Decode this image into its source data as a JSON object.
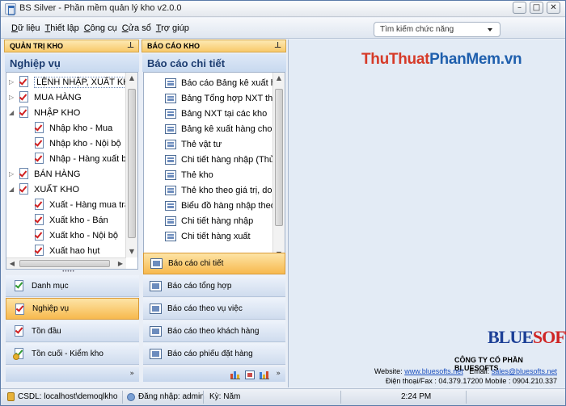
{
  "window": {
    "title": "BS Silver - Phần mềm quản lý kho v2.0.0",
    "buttons": [
      "–",
      "□",
      "✕"
    ]
  },
  "menu": {
    "items": [
      "Dữ liệu",
      "Thiết lập",
      "Công cụ",
      "Cửa sổ",
      "Trợ giúp"
    ],
    "search_value": "Tìm kiếm chức năng"
  },
  "left_panel": {
    "header": "QUẢN TRỊ KHO",
    "title": "Nghiệp vụ",
    "tree": [
      {
        "label": "LỆNH NHẬP, XUẤT KHO",
        "selected": true
      },
      {
        "label": "MUA HÀNG"
      },
      {
        "label": "NHẬP KHO"
      },
      {
        "label": "Nhập kho - Mua"
      },
      {
        "label": "Nhập kho - Nội bộ"
      },
      {
        "label": "Nhập - Hàng xuất bị"
      },
      {
        "label": "BÁN HÀNG"
      },
      {
        "label": "XUẤT KHO"
      },
      {
        "label": "Xuất - Hàng mua trả"
      },
      {
        "label": "Xuất kho - Bán"
      },
      {
        "label": "Xuất kho - Nội bộ"
      },
      {
        "label": "Xuất hao hụt"
      }
    ],
    "nav": [
      {
        "label": "Danh mục"
      },
      {
        "label": "Nghiệp vụ",
        "active": true
      },
      {
        "label": "Tồn đầu"
      },
      {
        "label": "Tồn cuối - Kiểm kho"
      }
    ]
  },
  "mid_panel": {
    "header": "BÁO CÁO KHO",
    "title": "Báo cáo chi tiết",
    "reports": [
      "Báo cáo Bảng kê xuất hàn",
      "Bảng Tổng hợp NXT theo",
      "Bảng NXT tại các kho",
      "Bảng kê xuất hàng cho từ",
      "Thẻ vật tư",
      "Chi tiết hàng nhập (Thủ k",
      "Thẻ kho",
      "Thẻ kho theo giá trị, doan",
      "Biểu đồ hàng nhập theo th",
      "Chi tiết hàng nhập",
      "Chi tiết hàng xuất"
    ],
    "nav": [
      {
        "label": "Báo cáo chi tiết",
        "active": true
      },
      {
        "label": "Báo cáo tổng hợp"
      },
      {
        "label": "Báo cáo theo vụ việc"
      },
      {
        "label": "Báo cáo theo khách hàng"
      },
      {
        "label": "Báo cáo phiếu đặt hàng"
      }
    ]
  },
  "content": {
    "watermark_part1": "ThuThuat",
    "watermark_part2": "PhanMem.vn",
    "logo_part1": "BLUE",
    "logo_part2": "SOFTS",
    "company": "CÔNG TY CỔ PHẦN BLUESOFTS",
    "website_label": "Website:",
    "website": "www.bluesofts.net",
    "email_label": "Email:",
    "email": "sales@bluesofts.net",
    "phone": "Điện thoại/Fax : 04.379.17200  Mobile : 0904.210.337"
  },
  "status": {
    "db": "CSDL: localhost\\demoqlkho",
    "login": "Đăng nhập: admin",
    "period": "Kỳ: Năm",
    "time": "2:24 PM"
  }
}
